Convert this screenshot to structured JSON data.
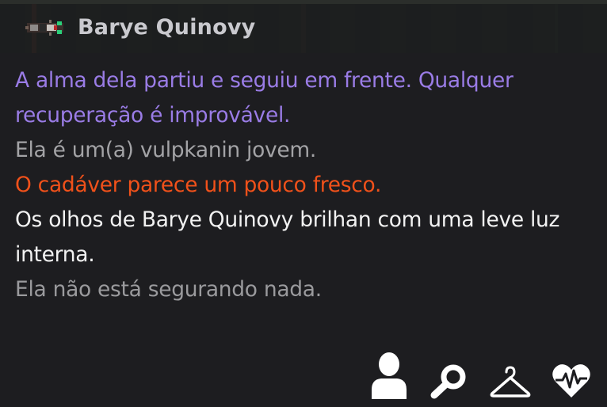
{
  "entity": {
    "name": "Barye Quinovy"
  },
  "examine": {
    "soul": "A alma dela partiu e seguiu em frente. Qualquer recuperação é improvável.",
    "age": "Ela é um(a) vulpkanin jovem.",
    "corpse": "O cadáver parece um pouco fresco.",
    "eyes": "Os olhos de Barye Quinovy brilhan com uma leve luz interna.",
    "holding": "Ela não está segurando nada."
  },
  "colors": {
    "soul": "#9a7ce6",
    "age": "#a3a3a6",
    "corpse": "#f1511a",
    "eyes": "#f2f2f2",
    "holding": "#9a9a9d"
  },
  "actions": [
    {
      "icon": "person-icon"
    },
    {
      "icon": "magnifier-icon"
    },
    {
      "icon": "hanger-icon"
    },
    {
      "icon": "heart-monitor-icon"
    }
  ]
}
